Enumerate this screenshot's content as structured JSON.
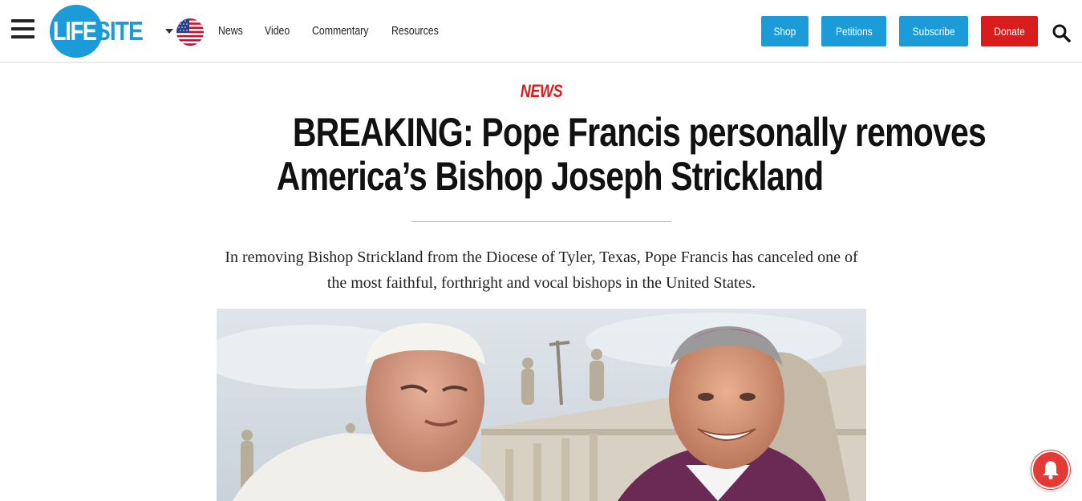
{
  "header": {
    "logo": {
      "part1": "LIFE",
      "part2": "SITE"
    },
    "region_icon": "us-flag-icon",
    "nav": [
      "News",
      "Video",
      "Commentary",
      "Resources"
    ],
    "buttons": {
      "shop": "Shop",
      "petitions": "Petitions",
      "subscribe": "Subscribe",
      "donate": "Donate"
    }
  },
  "article": {
    "kicker": "NEWS",
    "title_line1": "BREAKING: Pope Francis personally removes",
    "title_line2": "America’s Bishop Joseph Strickland",
    "dek": "In removing Bishop Strickland from the Diocese of Tyler, Texas, Pope Francis has canceled one of the most faithful, forthright and vocal bishops in the United States."
  },
  "colors": {
    "brand_blue": "#1b9bd7",
    "donate_red": "#d91c1c",
    "kicker_red": "#d91c1c",
    "bell_red": "#e53935"
  },
  "icons": [
    "menu-icon",
    "search-icon",
    "bell-icon",
    "caret-down-icon"
  ]
}
